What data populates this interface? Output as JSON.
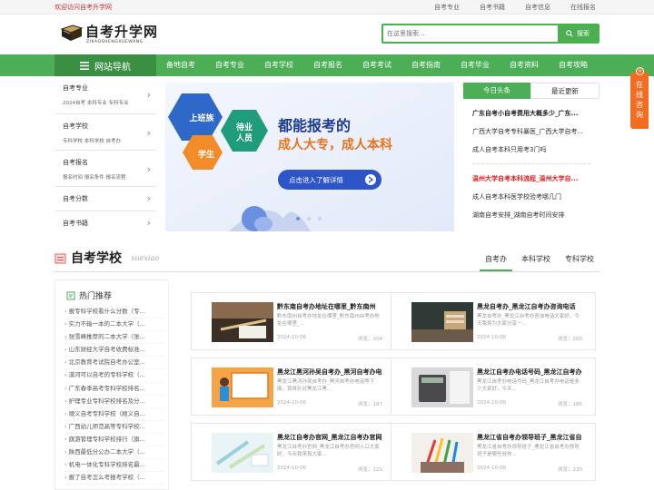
{
  "topbar": {
    "welcome": "欢迎访问自考升学网",
    "links": [
      "自考专业",
      "自考书籍",
      "自考信息",
      "在线报名"
    ]
  },
  "logo": {
    "title": "自考升学网",
    "pinyin": "ZIKAOSHENGXUEWANG"
  },
  "search": {
    "placeholder": "在这里搜索...",
    "button": "搜索"
  },
  "nav": {
    "home": "网站导航",
    "items": [
      "备地自考",
      "自考专业",
      "自考学校",
      "自考报名",
      "自考考试",
      "自考指南",
      "自考毕业",
      "自考资料",
      "自考攻略"
    ]
  },
  "float": {
    "text": "在线咨询",
    "close": "×"
  },
  "menu": [
    {
      "title": "自考专业",
      "sub": "2024自考 本科专业 专科专业"
    },
    {
      "title": "自考学校",
      "sub": "专科学校 本科学校 自考办"
    },
    {
      "title": "自考报名",
      "sub": "报名时间 报名条件 报名流程"
    },
    {
      "title": "自考分数",
      "sub": ""
    },
    {
      "title": "自考书籍",
      "sub": ""
    }
  ],
  "banner": {
    "tag1": "上班族",
    "tag2": "学生",
    "tag3a": "待业",
    "tag3b": "人员",
    "headline": "都能报考的",
    "slogan": "成人大专，成人本科",
    "cta": "点击进入了解详情"
  },
  "news": {
    "tab_on": "今日头条",
    "tab_off": "最近更新",
    "items": [
      "广东自考小自考费用大概多少_广东...",
      "广西大学自考专科暴医_广西大学自考...",
      "成人自考本科只用考3门吗",
      "温州大学自考本科流程_温州大学自...",
      "成人自考本科医学校验考哪几门",
      "湖南自考安排_湖南自考时间安排"
    ]
  },
  "section": {
    "title": "自考学校",
    "en": "xuexiao",
    "tabs": [
      "自考办",
      "本科学校",
      "专科学校"
    ]
  },
  "hot": {
    "title": "热门推荐",
    "items": [
      "报专科学校看什么分数（专...",
      "实力不输一本的二本大学（...",
      "张雪峰推荐的二本大学（张...",
      "山东财经大学自考收费标准...",
      "北京教育考试院自考办公室...",
      "漠河可以自考的专科学校（...",
      "广东春季高考专科学校排名...",
      "护理专业专科学校排名及分...",
      "顺义自考专科学校（顺义自...",
      "广西幼儿师范高等专科学校...",
      "旗游管理专科学校排行（旗...",
      "陕西最低分公办二本大学（...",
      "机电一体化专科学校排名最...",
      "报了自考怎么考报考学校（..."
    ]
  },
  "cards": [
    {
      "title": "黔东南自考办地址在哪里_黔东南州",
      "desc": "黔东南州自考办地址在哪里_黔东南州自考办地址在哪里_...",
      "date": "2024-10-06",
      "views": "浏览：204"
    },
    {
      "title": "黑龙自考办_黑龙江自考办咨询电话",
      "desc": "黑龙自考办_黑龙江自考办咨询电话大家好，今天我将为大家分享一...",
      "date": "2024-10-06",
      "views": "浏览：200"
    },
    {
      "title": "黑龙江黑河孙吴自考办_黑河自考办电",
      "desc": "黑龙江黑河孙吴自考办_黑河自考办电话等下面，我将针对黑龙江黑...",
      "date": "2024-10-06",
      "views": "浏览：187"
    },
    {
      "title": "黑龙江自考办电话号码_黑龙江自考办",
      "desc": "黑龙江自考办电话号码_黑龙江自考办电话是多少大家好，今天...",
      "date": "2024-10-06",
      "views": "浏览：185"
    },
    {
      "title": "黑龙江自考办官网_黑龙江自考办官网",
      "desc": "黑龙江自考办官网_黑龙江自考办官网入口大家好，今天我来和大家...",
      "date": "2024-10-06",
      "views": "浏览：121"
    },
    {
      "title": "黑龙江省自考办领导班子_黑龙江省自",
      "desc": "黑龙江省自考办领导班子_黑龙江省自考办领导班子是哪些谷你...",
      "date": "2024-10-06",
      "views": "浏览：230"
    }
  ]
}
